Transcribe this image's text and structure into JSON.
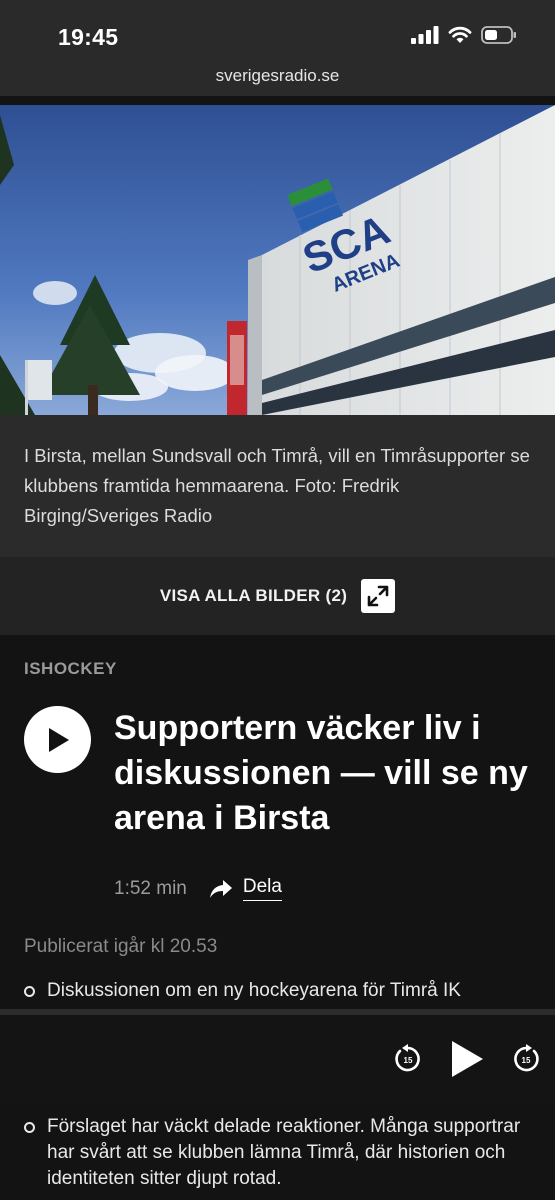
{
  "status_bar": {
    "time": "19:45"
  },
  "browser": {
    "url": "sverigesradio.se"
  },
  "hero": {
    "logo_main": "SCA",
    "logo_sub": "ARENA"
  },
  "caption": "I Birsta, mellan Sundsvall och Timrå, vill en Timråsupporter se klubbens framtida hemmaarena. Foto: Fredrik Birging/Sveriges Radio",
  "gallery": {
    "label": "VISA ALLA BILDER (2)"
  },
  "article": {
    "category": "ISHOCKEY",
    "headline": "Supportern väcker liv i diskussionen — vill se ny arena i Birsta",
    "duration": "1:52 min",
    "share_label": "Dela",
    "published": "Publicerat igår kl 20.53",
    "bullets": [
      "Diskussionen om en ny hockeyarena för Timrå IK",
      "Förslaget har väckt delade reaktioner. Många supportrar har svårt att se klubben lämna Timrå, där historien och identiteten sitter djupt rotad."
    ]
  },
  "player": {
    "rewind_seconds": "15",
    "forward_seconds": "15"
  }
}
